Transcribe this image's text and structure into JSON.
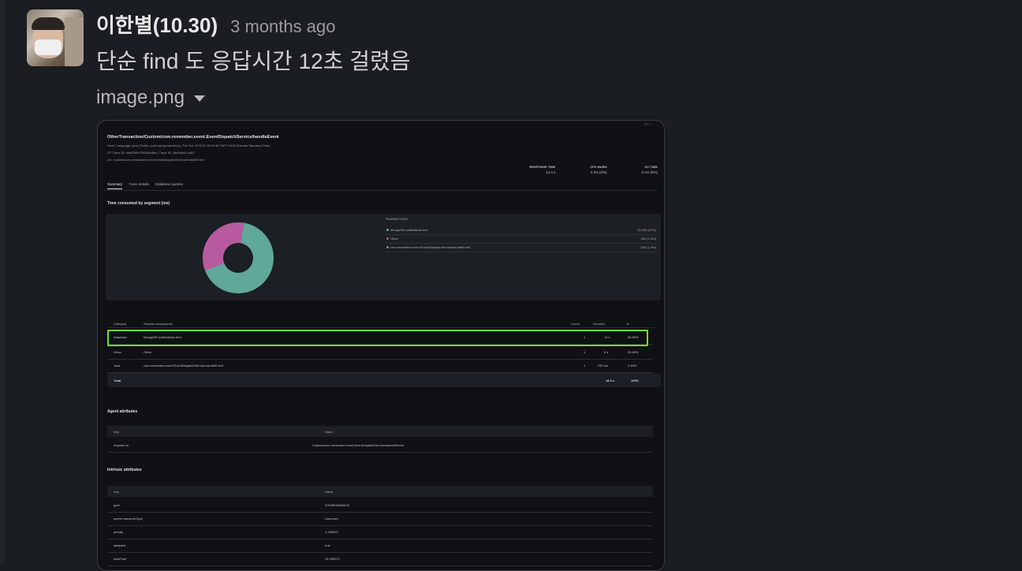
{
  "post": {
    "author": "이한별(10.30)",
    "time": "3 months ago",
    "message": "단순 find 도 응답시간 12초 걸렸음",
    "file_name": "image.png"
  },
  "screenshot": {
    "title": "OtherTransaction/Custom/com.remember.event.EventDispatchService/handleEvent",
    "meta_1": "Host | Language: java | Entity: push-api (production) | Tue Oct 18 2022 16:01:56 GMT+0900 (Korean Standard Time)",
    "meta_2": "DT Trace ID: ebd0390d7ff434fcdba | Trace ID: 1bc0b6d3-4d07",
    "meta_3": "Uri: /custom/com.remember.event.EventDispatchService/handleEvent",
    "metrics": [
      {
        "label": "RESPONSE TIME",
        "value": "12.3 s"
      },
      {
        "label": "CPU BURN",
        "value": "0 ms (0%)"
      },
      {
        "label": "GC TIME",
        "value": "0 ms (0%)"
      }
    ],
    "tabs": [
      "Summary",
      "Trace details",
      "Database queries"
    ],
    "segment_title": "Time consumed by segment (ms)",
    "legend_title": "TRANSACTION",
    "legend": [
      {
        "name": "MongoDB notifications find",
        "value": "12,000 (97%)",
        "color": "#5fa89a"
      },
      {
        "name": "Other",
        "value": "300 (2.4%)",
        "color": "#b85aa0"
      },
      {
        "name": "com.remember.event.EventDispatchService/handleEvent",
        "value": "290 (1.5%)",
        "color": "#5fa89a"
      }
    ],
    "donut": [
      {
        "name": "MongoDB notifications find",
        "value": 66.7,
        "color": "#5fa89a"
      },
      {
        "name": "Other",
        "value": 33.3,
        "color": "#b85aa0"
      }
    ],
    "table_headers": [
      "Category",
      "Slowest components",
      "Count",
      "Duration",
      "%"
    ],
    "table_rows": [
      {
        "category": "Database",
        "component": "MongoDB notifications find",
        "count": "1",
        "duration": "12 s",
        "pct": "69.85%"
      },
      {
        "category": "Other",
        "component": "Other",
        "count": "1",
        "duration": "6 s",
        "pct": "33.65%"
      },
      {
        "category": "Java",
        "component": "com.remember.event.EventDispatchService.handleEvent",
        "count": "1",
        "duration": "290 ms",
        "pct": "2.45%"
      }
    ],
    "total": {
      "label": "Total",
      "duration": "18.3 s",
      "pct": "100%"
    },
    "agent_title": "Agent attributes",
    "agent_headers": [
      "Key",
      "Value"
    ],
    "agent_rows": [
      {
        "key": "request.uri",
        "value": "Custom/com.remember.event.EventDispatchService/handleEvent"
      }
    ],
    "intrinsic_title": "Intrinsic attributes",
    "intrinsic_headers": [
      "Key",
      "Value"
    ],
    "intrinsic_rows": [
      {
        "key": "guid",
        "value": "07f0df93d0d5b7b"
      },
      {
        "key": "parent.transportType",
        "value": "Unknown"
      },
      {
        "key": "priority",
        "value": "1.246903"
      },
      {
        "key": "sampled",
        "value": "true"
      },
      {
        "key": "totalTime",
        "value": "24.339973"
      }
    ]
  }
}
